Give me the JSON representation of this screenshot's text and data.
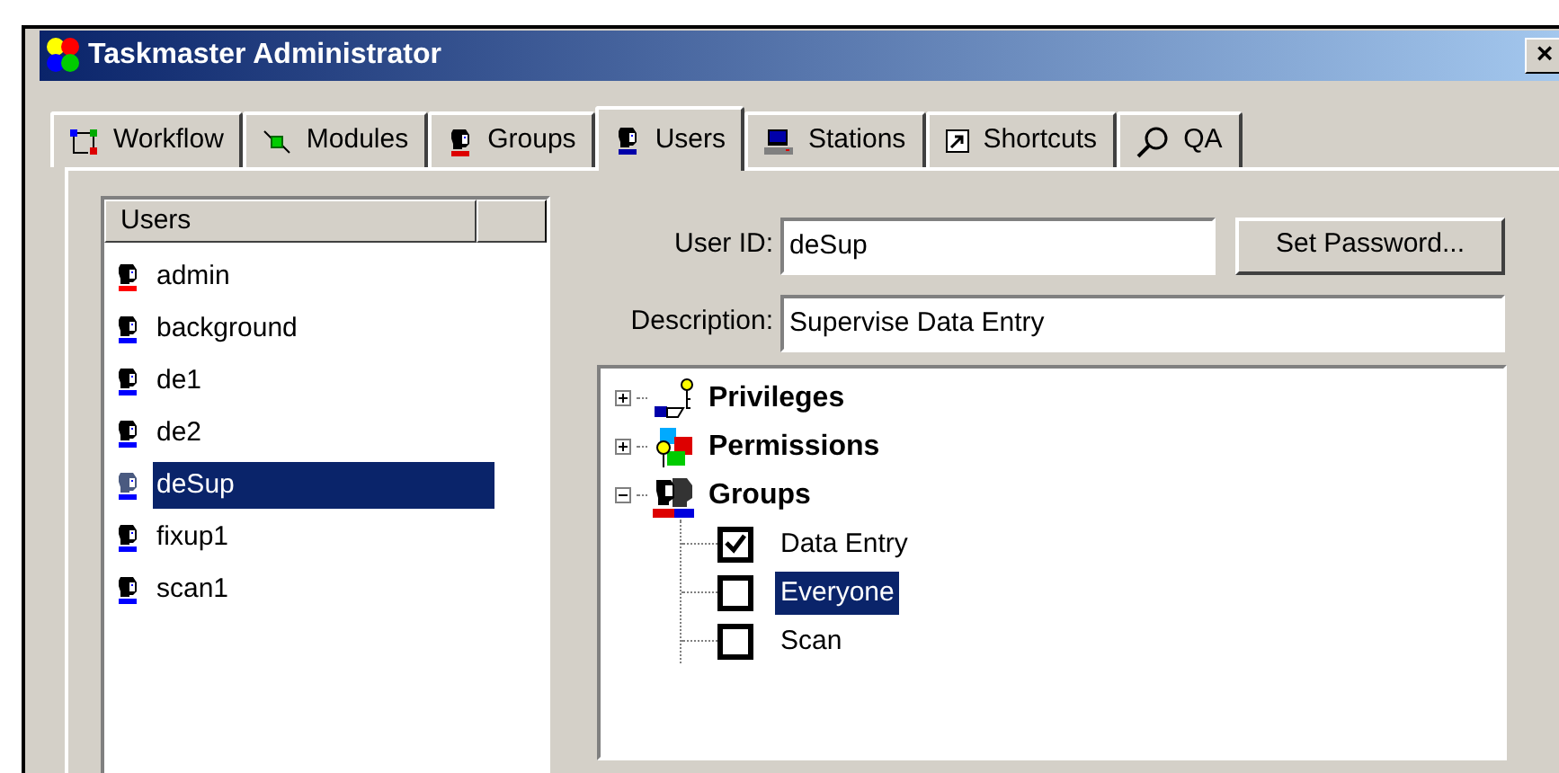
{
  "window": {
    "title": "Taskmaster Administrator",
    "close": "×"
  },
  "tabs": [
    {
      "label": "Workflow",
      "kind": "workflow",
      "selected": false
    },
    {
      "label": "Modules",
      "kind": "modules",
      "selected": false
    },
    {
      "label": "Groups",
      "kind": "groups",
      "selected": false
    },
    {
      "label": "Users",
      "kind": "user",
      "selected": true
    },
    {
      "label": "Stations",
      "kind": "station",
      "selected": false
    },
    {
      "label": "Shortcuts",
      "kind": "shortcut",
      "selected": false
    },
    {
      "label": "QA",
      "kind": "search",
      "selected": false
    }
  ],
  "users_list": {
    "column": "Users",
    "items": [
      {
        "name": "admin",
        "color": "#ff0000",
        "selected": false
      },
      {
        "name": "background",
        "color": "#0000ff",
        "selected": false
      },
      {
        "name": "de1",
        "color": "#0000ff",
        "selected": false
      },
      {
        "name": "de2",
        "color": "#0000ff",
        "selected": false
      },
      {
        "name": "deSup",
        "color": "#0000ff",
        "selected": true
      },
      {
        "name": "fixup1",
        "color": "#0000ff",
        "selected": false
      },
      {
        "name": "scan1",
        "color": "#0000ff",
        "selected": false
      }
    ]
  },
  "user_id": {
    "label": "User ID:",
    "value": "deSup"
  },
  "set_password": "Set Password...",
  "description": {
    "label": "Description:",
    "value": "Supervise Data Entry"
  },
  "tree": [
    {
      "label": "Privileges",
      "kind": "privileges",
      "expanded": false
    },
    {
      "label": "Permissions",
      "kind": "permissions",
      "expanded": false
    },
    {
      "label": "Groups",
      "kind": "groups",
      "expanded": true,
      "children": [
        {
          "label": "Data Entry",
          "checked": true,
          "selected": false
        },
        {
          "label": "Everyone",
          "checked": false,
          "selected": true
        },
        {
          "label": "Scan",
          "checked": false,
          "selected": false
        }
      ]
    }
  ]
}
